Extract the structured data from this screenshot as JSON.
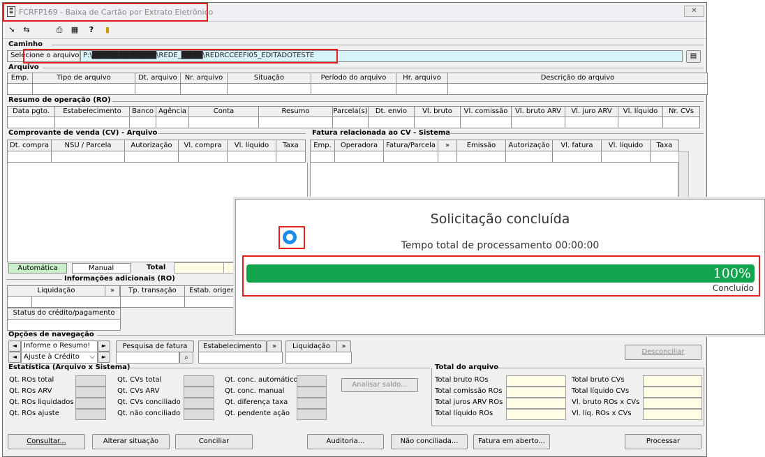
{
  "window": {
    "title": "FCRFP169 - Baixa de Cartão por Extrato Eletrônico",
    "close": "✕"
  },
  "toolbar": {
    "icons": [
      "arrow-icon",
      "swap-icon",
      "print-icon",
      "calculator-icon",
      "help-icon",
      "exit-icon"
    ]
  },
  "caminho": {
    "section": "Caminho",
    "button": "Selecione o arquivo",
    "path": "P:\\████████████\\REDE_████\\REDRCCEEFI05_EDITADOTESTE"
  },
  "arquivo": {
    "section": "Arquivo",
    "columns": [
      "Emp.",
      "Tipo de arquivo",
      "Dt. arquivo",
      "Nr. arquivo",
      "Situação",
      "Período do arquivo",
      "Hr. arquivo",
      "Descrição do arquivo"
    ]
  },
  "resumo": {
    "section": "Resumo de operação (RO)",
    "columns": [
      "Data pgto.",
      "Estabelecimento",
      "Banco",
      "Agência",
      "Conta",
      "Resumo",
      "Parcela(s)",
      "Dt. envio",
      "Vl. bruto",
      "Vl. comissão",
      "Vl. bruto ARV",
      "Vl. juro ARV",
      "Vl. líquido",
      "Nr. CVs"
    ]
  },
  "comprovante": {
    "section": "Comprovante de venda (CV) - Arquivo",
    "columns": [
      "Dt. compra",
      "NSU / Parcela",
      "Autorização",
      "Vl. compra",
      "Vl. líquido",
      "Taxa"
    ]
  },
  "fatura": {
    "section": "Fatura relacionada ao CV - Sistema",
    "columns": [
      "Emp.",
      "Operadora",
      "Fatura/Parcela",
      "»",
      "Emissão",
      "Autorização",
      "Vl. fatura",
      "Vl. líquido",
      "Taxa"
    ]
  },
  "modes": {
    "auto": "Automática",
    "manual": "Manual",
    "total": "Total"
  },
  "info": {
    "section": "Informações adicionais (RO)",
    "liquidacao": "Liquidação",
    "more": "»",
    "tp_transacao": "Tp. transação",
    "estab_origem": "Estab. origem",
    "status": "Status do crédito/pagamento"
  },
  "nav": {
    "section": "Opções de navegação",
    "left": "◄",
    "right": "►",
    "informe": "Informe o Resumo!",
    "ajuste": "Ajuste à Crédito",
    "pesquisa": "Pesquisa de fatura",
    "estabelecimento": "Estabelecimento",
    "liquidacao": "Liquidação",
    "more": "»",
    "desconciliar": "Desconciliar"
  },
  "estat": {
    "section": "Estatística (Arquivo x Sistema)",
    "c1": [
      "Qt. ROs total",
      "Qt. ROs ARV",
      "Qt. ROs liquidados",
      "Qt. ROs ajuste"
    ],
    "c2": [
      "Qt. CVs total",
      "Qt. CVs ARV",
      "Qt. CVs conciliado",
      "Qt. não conciliado"
    ],
    "c3": [
      "Qt. conc. automático",
      "Qt. conc. manual",
      "Qt. diferença taxa",
      "Qt. pendente ação"
    ],
    "analisar": "Analisar saldo..."
  },
  "total": {
    "section": "Total do arquivo",
    "c1": [
      "Total bruto ROs",
      "Total comissão ROs",
      "Total juros ARV ROs",
      "Total líquido ROs"
    ],
    "c2": [
      "Total bruto CVs",
      "Total líquido CVs",
      "Vl. bruto ROs x CVs",
      "Vl. líq. ROs x CVs"
    ]
  },
  "buttons": {
    "consultar": "Consultar...",
    "alterar": "Alterar situação",
    "conciliar": "Conciliar",
    "auditoria": "Auditoria...",
    "naoconc": "Não conciliada...",
    "fatura": "Fatura em aberto...",
    "processar": "Processar"
  },
  "dialog": {
    "title": "Solicitação concluída",
    "time": "Tempo total de processamento 00:00:00",
    "progress": 1.0,
    "percent": "100%",
    "status": "Concluído",
    "bar_color": "#12a54e"
  }
}
